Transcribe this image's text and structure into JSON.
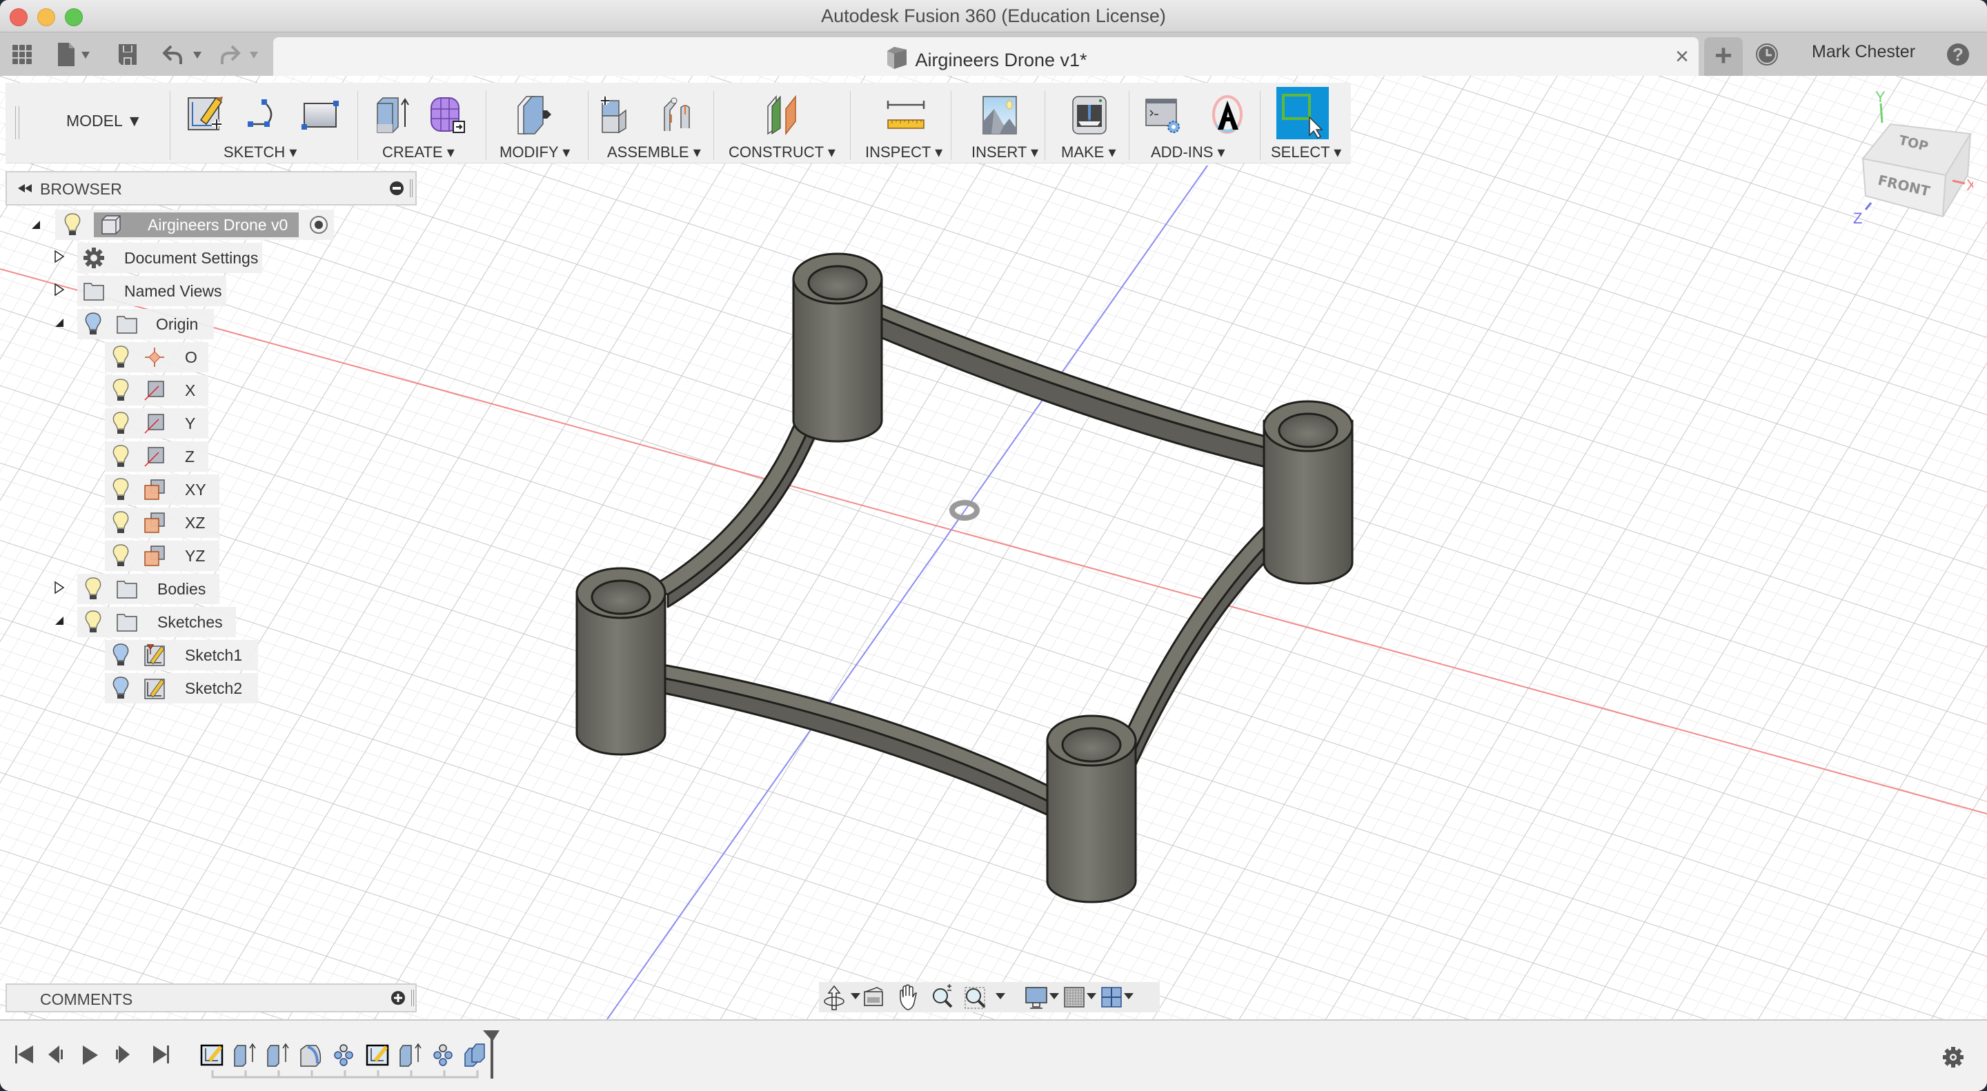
{
  "window": {
    "title": "Autodesk Fusion 360 (Education License)"
  },
  "tabbar": {
    "document_tab": "Airgineers Drone v1*",
    "close_symbol": "×",
    "new_tab_symbol": "+",
    "user_name": "Mark Chester",
    "icons": [
      "app-grid-icon",
      "file-icon",
      "save-icon",
      "undo-icon",
      "redo-icon",
      "job-status-icon",
      "help-icon"
    ]
  },
  "toolbar": {
    "mode": "MODEL ▼",
    "groups": [
      {
        "label": "SKETCH ▾",
        "icons": [
          "create-sketch-icon",
          "arc-icon",
          "rectangle-icon"
        ]
      },
      {
        "label": "CREATE ▾",
        "icons": [
          "extrude-icon",
          "create-form-icon"
        ]
      },
      {
        "label": "MODIFY ▾",
        "icons": [
          "press-pull-icon"
        ]
      },
      {
        "label": "ASSEMBLE ▾",
        "icons": [
          "new-component-icon",
          "joint-icon"
        ]
      },
      {
        "label": "CONSTRUCT ▾",
        "icons": [
          "offset-plane-icon"
        ]
      },
      {
        "label": "INSPECT ▾",
        "icons": [
          "measure-icon"
        ]
      },
      {
        "label": "INSERT ▾",
        "icons": [
          "insert-image-icon"
        ]
      },
      {
        "label": "MAKE ▾",
        "icons": [
          "3d-print-icon"
        ]
      },
      {
        "label": "ADD-INS ▾",
        "icons": [
          "scripts-addins-icon",
          "autodesk-app-store-icon"
        ]
      },
      {
        "label": "SELECT ▾",
        "icons": [
          "window-select-icon"
        ]
      }
    ]
  },
  "browser": {
    "title": "BROWSER",
    "root": "Airgineers Drone v0",
    "items": [
      {
        "label": "Document Settings",
        "icon": "gear-icon",
        "expand": "collapsed",
        "visible_toggle": false
      },
      {
        "label": "Named Views",
        "icon": "folder-icon",
        "expand": "collapsed",
        "visible_toggle": false
      },
      {
        "label": "Origin",
        "icon": "folder-icon",
        "expand": "expanded",
        "visible_toggle": true,
        "bulb": "off"
      },
      {
        "label": "O",
        "icon": "origin-point-icon",
        "level": 2,
        "bulb": "on"
      },
      {
        "label": "X",
        "icon": "axis-icon",
        "level": 2,
        "bulb": "on"
      },
      {
        "label": "Y",
        "icon": "axis-icon",
        "level": 2,
        "bulb": "on"
      },
      {
        "label": "Z",
        "icon": "axis-icon",
        "level": 2,
        "bulb": "on"
      },
      {
        "label": "XY",
        "icon": "plane-icon",
        "level": 2,
        "bulb": "on"
      },
      {
        "label": "XZ",
        "icon": "plane-icon",
        "level": 2,
        "bulb": "on"
      },
      {
        "label": "YZ",
        "icon": "plane-icon",
        "level": 2,
        "bulb": "on"
      },
      {
        "label": "Bodies",
        "icon": "folder-icon",
        "expand": "collapsed",
        "visible_toggle": true,
        "bulb": "on"
      },
      {
        "label": "Sketches",
        "icon": "folder-icon",
        "expand": "expanded",
        "visible_toggle": true,
        "bulb": "on"
      },
      {
        "label": "Sketch1",
        "icon": "sketch-icon",
        "level": 2,
        "bulb": "off"
      },
      {
        "label": "Sketch2",
        "icon": "sketch-icon",
        "level": 2,
        "bulb": "off"
      }
    ]
  },
  "comments": {
    "title": "COMMENTS"
  },
  "viewcube": {
    "top": "TOP",
    "front": "FRONT",
    "axis_x": "X",
    "axis_y": "Y",
    "axis_z": "Z"
  },
  "navbar": {
    "icons": [
      "orbit-icon",
      "look-at-icon",
      "pan-icon",
      "zoom-icon",
      "fit-icon",
      "display-settings-icon",
      "grid-snaps-icon",
      "viewports-icon"
    ]
  },
  "timeline": {
    "controls": [
      "go-to-start-icon",
      "step-back-icon",
      "play-icon",
      "step-forward-icon",
      "go-to-end-icon"
    ],
    "features": [
      "sketch",
      "extrude",
      "extrude",
      "fillet",
      "pattern",
      "sketch",
      "extrude",
      "pattern",
      "combine"
    ]
  },
  "colors": {
    "accent_select": "#0f93d8",
    "model_body": "#6b6a62",
    "axis_x": "#f07070",
    "axis_z": "#7a7aef",
    "axis_y": "#5ccc5c"
  }
}
